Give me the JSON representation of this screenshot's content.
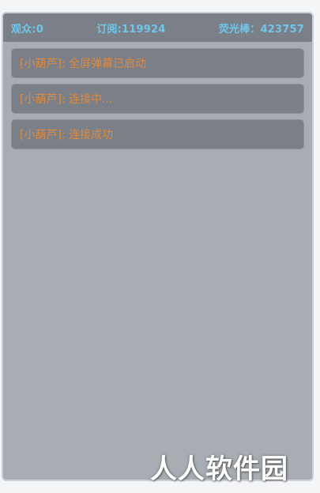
{
  "header": {
    "viewers": "观众:0",
    "subscriptions": "订阅:119924",
    "glowsticks": "荧光棒：423757"
  },
  "messages": [
    {
      "text": "[小葫芦]: 全屏弹幕已启动"
    },
    {
      "text": "[小葫芦]: 连接中..."
    },
    {
      "text": "[小葫芦]: 连接成功"
    }
  ],
  "watermark": "人人软件园",
  "colors": {
    "background": "#a7adb2",
    "bar": "#7b7f88",
    "header_text": "#6fc6ea",
    "message_text": "#e08a3c"
  }
}
